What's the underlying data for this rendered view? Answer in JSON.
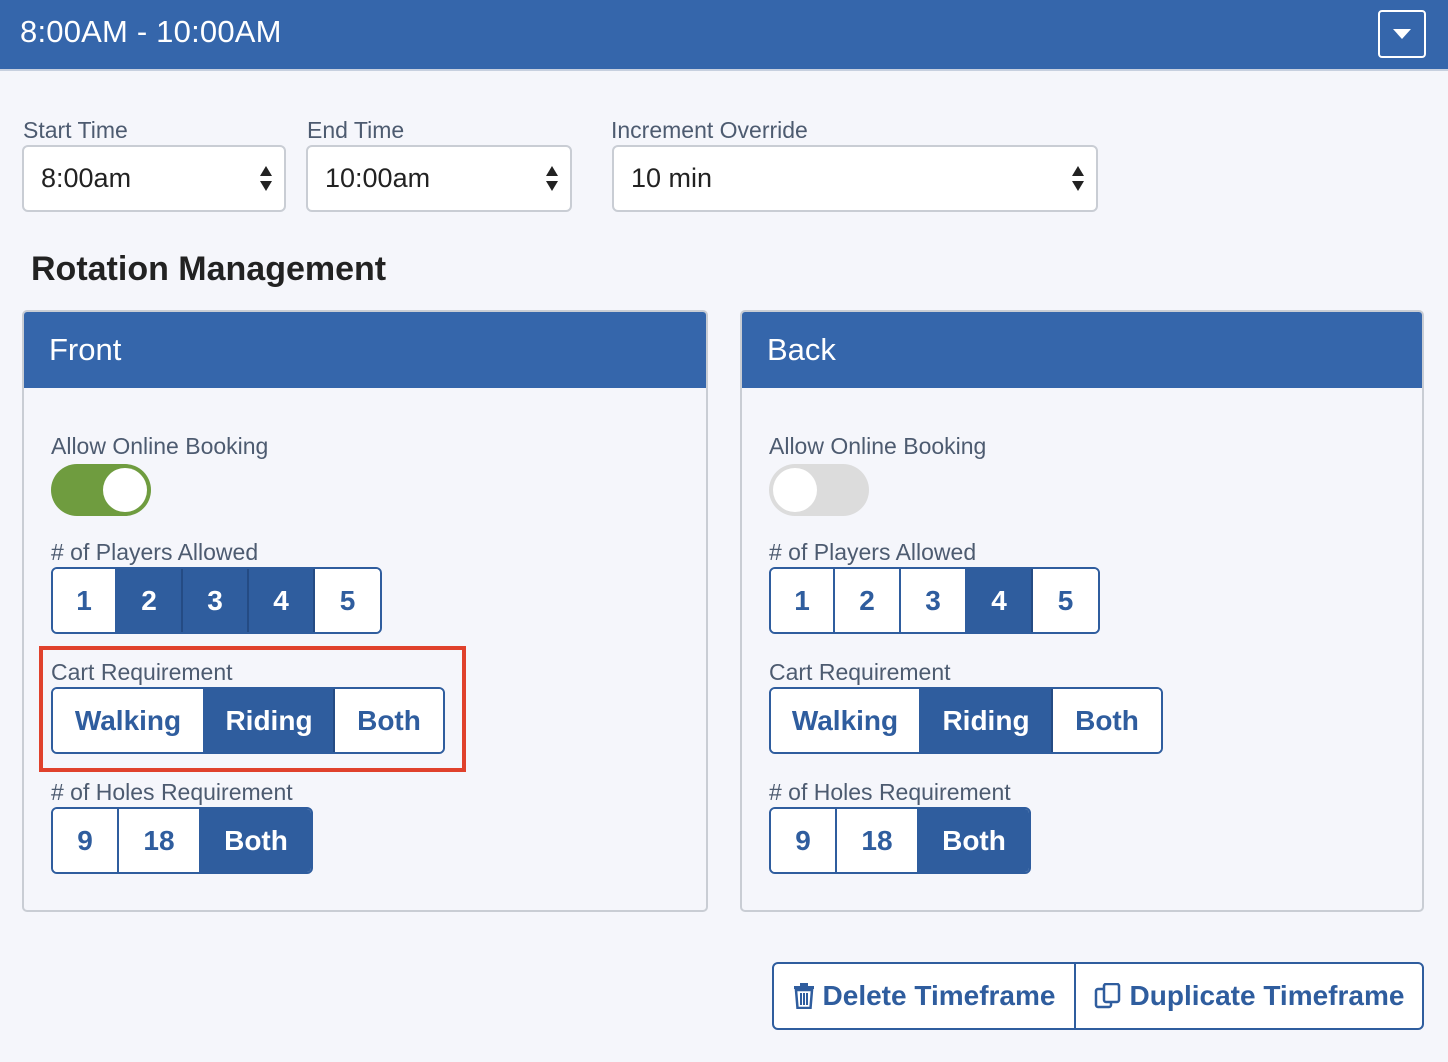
{
  "header": {
    "title": "8:00AM - 10:00AM"
  },
  "fields": {
    "start_time": {
      "label": "Start Time",
      "value": "8:00am"
    },
    "end_time": {
      "label": "End Time",
      "value": "10:00am"
    },
    "increment": {
      "label": "Increment Override",
      "value": "10 min"
    }
  },
  "section_title": "Rotation Management",
  "panels": [
    {
      "title": "Front",
      "online_booking_label": "Allow Online Booking",
      "online_booking_on": true,
      "players_label": "# of Players Allowed",
      "players": [
        "1",
        "2",
        "3",
        "4",
        "5"
      ],
      "players_selected": [
        "2",
        "3",
        "4"
      ],
      "cart_label": "Cart Requirement",
      "cart": [
        "Walking",
        "Riding",
        "Both"
      ],
      "cart_selected": "Riding",
      "holes_label": "# of Holes Requirement",
      "holes": [
        "9",
        "18",
        "Both"
      ],
      "holes_selected": "Both"
    },
    {
      "title": "Back",
      "online_booking_label": "Allow Online Booking",
      "online_booking_on": false,
      "players_label": "# of Players Allowed",
      "players": [
        "1",
        "2",
        "3",
        "4",
        "5"
      ],
      "players_selected": [
        "4"
      ],
      "cart_label": "Cart Requirement",
      "cart": [
        "Walking",
        "Riding",
        "Both"
      ],
      "cart_selected": "Riding",
      "holes_label": "# of Holes Requirement",
      "holes": [
        "9",
        "18",
        "Both"
      ],
      "holes_selected": "Both"
    }
  ],
  "actions": {
    "delete_label": "Delete Timeframe",
    "duplicate_label": "Duplicate Timeframe"
  },
  "icons": {
    "dropdown": "caret-down-icon",
    "delete": "trash-icon",
    "duplicate": "copy-icon",
    "select_arrows": "sort-arrows-icon"
  },
  "colors": {
    "primary": "#3566ab",
    "button_blue": "#2f5d9e",
    "toggle_on": "#6f9c3f",
    "toggle_off": "#dcdcdc",
    "highlight": "#e0412c"
  }
}
